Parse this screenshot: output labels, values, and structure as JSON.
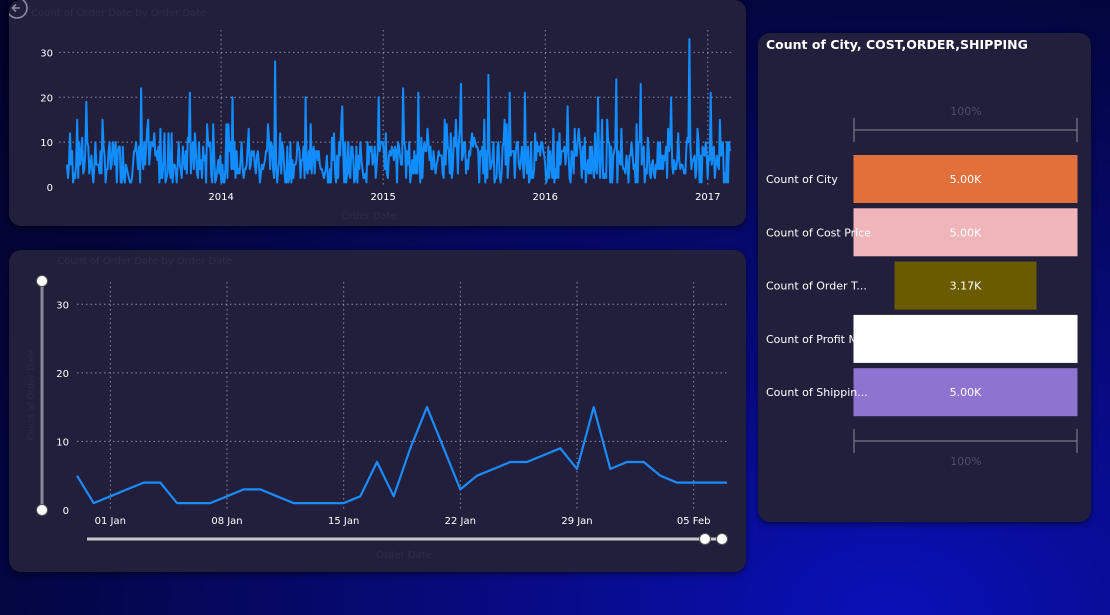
{
  "top_chart": {
    "title": "Count of Order Date by Order Date",
    "x_axis_label": "Order Date",
    "y_ticks": [
      "0",
      "10",
      "20",
      "30"
    ],
    "x_ticks": [
      "2014",
      "2015",
      "2016",
      "2017"
    ],
    "line_color": "#118dff"
  },
  "bottom_chart": {
    "title": "Count of Order Date by Order Date",
    "x_axis_label": "Order Date",
    "y_axis_label": "Count of Order Date",
    "y_ticks": [
      "0",
      "10",
      "20",
      "30"
    ],
    "x_ticks": [
      "01 Jan",
      "08 Jan",
      "15 Jan",
      "22 Jan",
      "29 Jan",
      "05 Feb"
    ],
    "line_color": "#1a8cff"
  },
  "funnel": {
    "title": "Count of City, COST,ORDER,SHIPPING",
    "top_percent": "100%",
    "bottom_percent": "100%",
    "items": [
      {
        "label": "Count of City",
        "value_label": "5.00K",
        "color": "#e2703a"
      },
      {
        "label": "Count of Cost Price",
        "value_label": "5.00K",
        "color": "#efb5b9"
      },
      {
        "label": "Count of Order T...",
        "value_label": "3.17K",
        "color": "#6b5b00"
      },
      {
        "label": "Count of Profit M",
        "value_label": "",
        "color": "#ffffff"
      },
      {
        "label": "Count of Shippin...",
        "value_label": "5.00K",
        "color": "#8f73d0"
      }
    ]
  },
  "chart_data": [
    {
      "type": "line",
      "title": "",
      "xlabel": "",
      "ylabel": "",
      "xlim": [
        "2013-01-01",
        "2017-03-01"
      ],
      "ylim": [
        0,
        35
      ],
      "x_ticks": [
        "2014",
        "2015",
        "2016",
        "2017"
      ],
      "grid": true,
      "series": [
        {
          "x": [
            "2013-02-10",
            "2013-06-15",
            "2013-10-10",
            "2014-01-15",
            "2014-04-20",
            "2014-06-28",
            "2014-09-20",
            "2014-12-15",
            "2015-02-10",
            "2015-03-15",
            "2015-06-20",
            "2015-08-25",
            "2015-10-15",
            "2015-11-20",
            "2016-02-20",
            "2016-05-01",
            "2016-06-15",
            "2016-08-10",
            "2016-10-15",
            "2016-12-01",
            "2017-01-20",
            "2017-02-10"
          ],
          "y": [
            19,
            22,
            21,
            20,
            28,
            20,
            18,
            20,
            22,
            21,
            23,
            25,
            21,
            21,
            18,
            20,
            24,
            23,
            20,
            33,
            21,
            15
          ]
        }
      ]
    },
    {
      "type": "line",
      "title": "",
      "xlabel": "",
      "ylabel": "",
      "ylim": [
        0,
        35
      ],
      "x_ticks": [
        "01 Jan",
        "08 Jan",
        "15 Jan",
        "22 Jan",
        "29 Jan",
        "05 Feb"
      ],
      "grid": true,
      "series": [
        {
          "x": [
            "30 Dec",
            "31 Dec",
            "01 Jan",
            "02 Jan",
            "03 Jan",
            "04 Jan",
            "05 Jan",
            "06 Jan",
            "07 Jan",
            "08 Jan",
            "09 Jan",
            "10 Jan",
            "11 Jan",
            "12 Jan",
            "13 Jan",
            "14 Jan",
            "15 Jan",
            "16 Jan",
            "17 Jan",
            "18 Jan",
            "19 Jan",
            "20 Jan",
            "21 Jan",
            "22 Jan",
            "23 Jan",
            "24 Jan",
            "25 Jan",
            "26 Jan",
            "27 Jan",
            "28 Jan",
            "29 Jan",
            "30 Jan",
            "31 Jan",
            "01 Feb",
            "02 Feb",
            "03 Feb",
            "04 Feb",
            "05 Feb",
            "06 Feb",
            "07 Feb"
          ],
          "y": [
            5,
            1,
            2,
            3,
            4,
            4,
            1,
            1,
            1,
            2,
            3,
            3,
            2,
            1,
            1,
            1,
            1,
            2,
            7,
            2,
            9,
            15,
            9,
            3,
            5,
            6,
            7,
            7,
            8,
            9,
            6,
            15,
            6,
            7,
            7,
            5,
            4,
            4,
            4,
            4
          ]
        }
      ]
    },
    {
      "type": "bar",
      "title": "Count of City, COST,ORDER,SHIPPING",
      "categories": [
        "Count of City",
        "Count of Cost Price",
        "Count of Order T...",
        "Count of Profit M",
        "Count of Shippin..."
      ],
      "values": [
        5000,
        5000,
        3170,
        5000,
        5000
      ],
      "value_labels": [
        "5.00K",
        "5.00K",
        "3.17K",
        "",
        "5.00K"
      ]
    }
  ]
}
